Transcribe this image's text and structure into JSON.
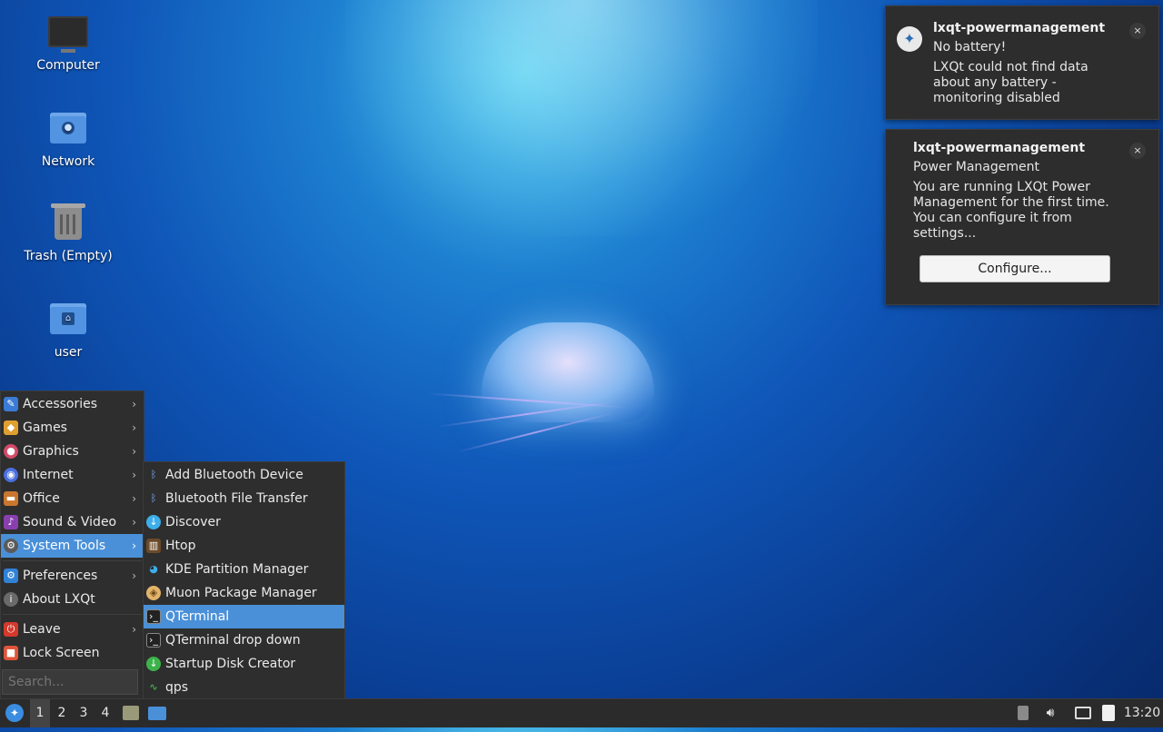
{
  "desktop": {
    "icons": [
      {
        "label": "Computer",
        "icon": "computer-icon"
      },
      {
        "label": "Network",
        "icon": "network-folder-icon"
      },
      {
        "label": "Trash (Empty)",
        "icon": "trash-icon"
      },
      {
        "label": "user",
        "icon": "home-folder-icon"
      }
    ]
  },
  "notifications": [
    {
      "app": "lxqt-powermanagement",
      "summary": "No battery!",
      "body_lines": [
        "LXQt could not find data",
        "about any battery -",
        "monitoring disabled"
      ],
      "close": "×"
    },
    {
      "app": "lxqt-powermanagement",
      "summary": "Power Management",
      "body_lines": [
        "You are running LXQt Power",
        "Management for the first time.",
        "You can configure it from",
        "settings..."
      ],
      "action": "Configure...",
      "close": "×"
    }
  ],
  "main_menu": {
    "items": [
      {
        "label": "Accessories",
        "icon": "accessories-icon",
        "color": "#3a7bd5"
      },
      {
        "label": "Games",
        "icon": "games-icon",
        "color": "#e0a030"
      },
      {
        "label": "Graphics",
        "icon": "graphics-icon",
        "color": "#d24b6a"
      },
      {
        "label": "Internet",
        "icon": "internet-icon",
        "color": "#4a6fe0"
      },
      {
        "label": "Office",
        "icon": "office-icon",
        "color": "#c9772e"
      },
      {
        "label": "Sound & Video",
        "icon": "sound-video-icon",
        "color": "#8a3fb0"
      },
      {
        "label": "System Tools",
        "icon": "system-tools-icon",
        "color": "#5a5a5a"
      },
      {
        "label": "Preferences",
        "icon": "preferences-icon",
        "color": "#2f82d6"
      },
      {
        "label": "About LXQt",
        "icon": "info-icon",
        "color": "#6a6a6a"
      },
      {
        "label": "Leave",
        "icon": "power-icon",
        "color": "#d33a2c"
      },
      {
        "label": "Lock Screen",
        "icon": "lock-icon",
        "color": "#e0553a"
      }
    ],
    "search_placeholder": "Search..."
  },
  "system_tools_menu": {
    "items": [
      {
        "label": "Add Bluetooth Device",
        "icon": "bluetooth-icon"
      },
      {
        "label": "Bluetooth File Transfer",
        "icon": "bluetooth-icon"
      },
      {
        "label": "Discover",
        "icon": "discover-icon"
      },
      {
        "label": "Htop",
        "icon": "htop-icon"
      },
      {
        "label": "KDE Partition Manager",
        "icon": "partition-manager-icon"
      },
      {
        "label": "Muon Package Manager",
        "icon": "package-manager-icon"
      },
      {
        "label": "QTerminal",
        "icon": "terminal-icon"
      },
      {
        "label": "QTerminal drop down",
        "icon": "terminal-icon"
      },
      {
        "label": "Startup Disk Creator",
        "icon": "startup-disk-icon"
      },
      {
        "label": "qps",
        "icon": "qps-icon"
      }
    ],
    "highlighted": "QTerminal"
  },
  "taskbar": {
    "workspaces": [
      "1",
      "2",
      "3",
      "4"
    ],
    "active_workspace": "1",
    "clock": "13:20"
  }
}
